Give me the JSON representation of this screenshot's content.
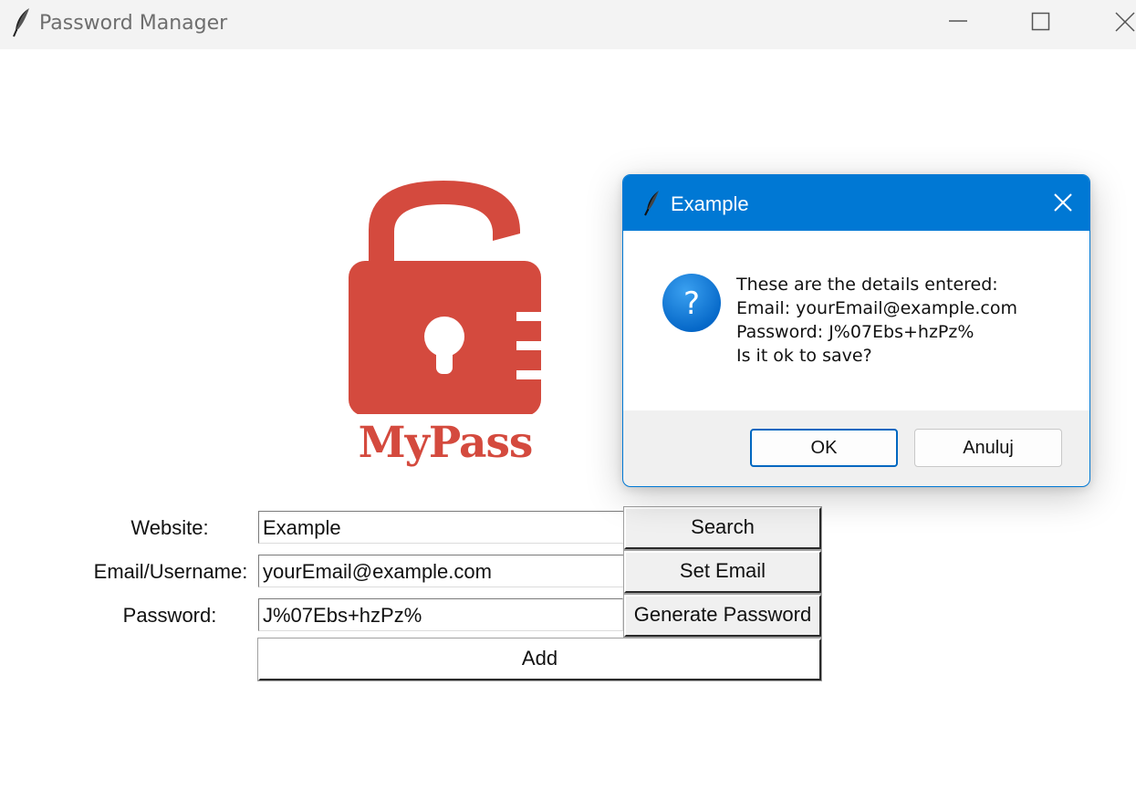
{
  "window": {
    "title": "Password Manager"
  },
  "logo": {
    "text": "MyPass",
    "color": "#d44a3e"
  },
  "form": {
    "website_label": "Website:",
    "website_value": "Example",
    "email_label": "Email/Username:",
    "email_value": "yourEmail@example.com",
    "password_label": "Password:",
    "password_value": "J%07Ebs+hzPz%",
    "search_label": "Search",
    "set_email_label": "Set Email",
    "generate_label": "Generate Password",
    "add_label": "Add"
  },
  "dialog": {
    "title": "Example",
    "icon": "question-icon",
    "message_lines": [
      "These are the details entered:",
      "Email: yourEmail@example.com",
      "Password: J%07Ebs+hzPz%",
      "Is it ok to save?"
    ],
    "ok_label": "OK",
    "cancel_label": "Anuluj",
    "accent_color": "#0078d4"
  }
}
